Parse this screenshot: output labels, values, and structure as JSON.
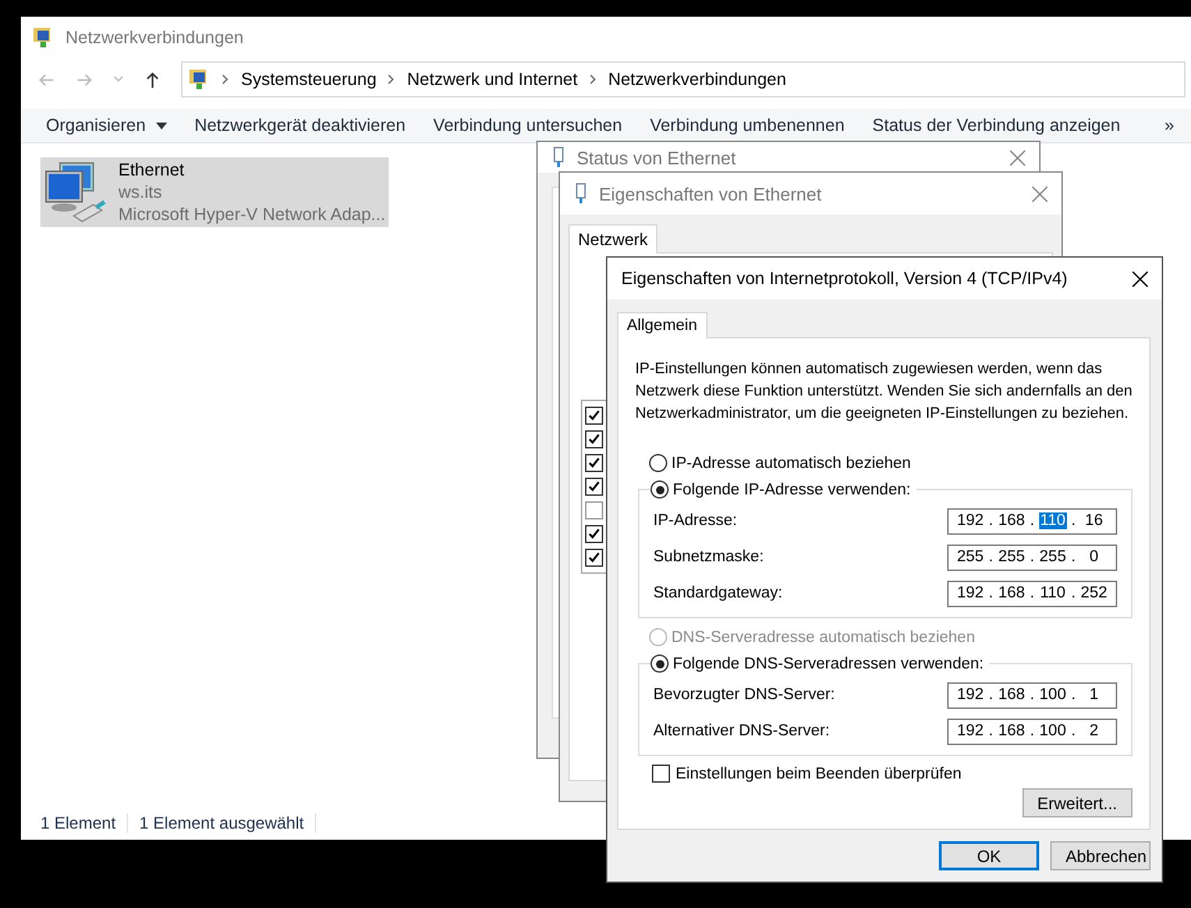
{
  "explorer": {
    "title": "Netzwerkverbindungen",
    "breadcrumbs": [
      "Systemsteuerung",
      "Netzwerk und Internet",
      "Netzwerkverbindungen"
    ],
    "toolbar": [
      {
        "label": "Organisieren",
        "dropdown": true
      },
      {
        "label": "Netzwerkgerät deaktivieren",
        "dropdown": false
      },
      {
        "label": "Verbindung untersuchen",
        "dropdown": false
      },
      {
        "label": "Verbindung umbenennen",
        "dropdown": false
      },
      {
        "label": "Status der Verbindung anzeigen",
        "dropdown": false
      }
    ],
    "overflow": "»",
    "items": [
      {
        "name": "Ethernet",
        "domain": "ws.its",
        "adapter": "Microsoft Hyper-V Network Adap...",
        "selected": true
      }
    ],
    "status_bar": [
      "1 Element",
      "1 Element ausgewählt"
    ]
  },
  "status_dialog": {
    "title": "Status von Ethernet"
  },
  "ethernet_dialog": {
    "title": "Eigenschaften von Ethernet",
    "tabs": [
      {
        "label": "Netzwerk",
        "selected": true
      }
    ],
    "components": [
      {
        "checked": true
      },
      {
        "checked": true
      },
      {
        "checked": true
      },
      {
        "checked": true
      },
      {
        "checked": false
      },
      {
        "checked": true
      },
      {
        "checked": true
      }
    ]
  },
  "ipv4_dialog": {
    "title": "Eigenschaften von Internetprotokoll, Version 4 (TCP/IPv4)",
    "tabs": [
      {
        "label": "Allgemein",
        "selected": true
      }
    ],
    "description": "IP-Einstellungen können automatisch zugewiesen werden, wenn das Netzwerk diese Funktion unterstützt. Wenden Sie sich andernfalls an den Netzwerkadministrator, um die geeigneten IP-Einstellungen zu beziehen.",
    "octet_separator": ".",
    "ip_options": [
      {
        "label": "IP-Adresse automatisch beziehen",
        "selected": false,
        "disabled": false
      },
      {
        "label": "Folgende IP-Adresse verwenden:",
        "selected": true,
        "disabled": false
      }
    ],
    "ip_fields": [
      {
        "label": "IP-Adresse:",
        "octets": [
          {
            "value": "192",
            "selected": false
          },
          {
            "value": "168",
            "selected": false
          },
          {
            "value": "110",
            "selected": true
          },
          {
            "value": "16",
            "selected": false
          }
        ]
      },
      {
        "label": "Subnetzmaske:",
        "octets": [
          {
            "value": "255",
            "selected": false
          },
          {
            "value": "255",
            "selected": false
          },
          {
            "value": "255",
            "selected": false
          },
          {
            "value": "0",
            "selected": false
          }
        ]
      },
      {
        "label": "Standardgateway:",
        "octets": [
          {
            "value": "192",
            "selected": false
          },
          {
            "value": "168",
            "selected": false
          },
          {
            "value": "110",
            "selected": false
          },
          {
            "value": "252",
            "selected": false
          }
        ]
      }
    ],
    "dns_options": [
      {
        "label": "DNS-Serveradresse automatisch beziehen",
        "selected": false,
        "disabled": true
      },
      {
        "label": "Folgende DNS-Serveradressen verwenden:",
        "selected": true,
        "disabled": false
      }
    ],
    "dns_fields": [
      {
        "label": "Bevorzugter DNS-Server:",
        "octets": [
          {
            "value": "192",
            "selected": false
          },
          {
            "value": "168",
            "selected": false
          },
          {
            "value": "100",
            "selected": false
          },
          {
            "value": "1",
            "selected": false
          }
        ]
      },
      {
        "label": "Alternativer DNS-Server:",
        "octets": [
          {
            "value": "192",
            "selected": false
          },
          {
            "value": "168",
            "selected": false
          },
          {
            "value": "100",
            "selected": false
          },
          {
            "value": "2",
            "selected": false
          }
        ]
      }
    ],
    "validate": {
      "label": "Einstellungen beim Beenden überprüfen",
      "checked": false
    },
    "advanced_button": "Erweitert...",
    "buttons": [
      {
        "label": "OK",
        "default": true
      },
      {
        "label": "Abbrechen",
        "default": false
      }
    ]
  }
}
